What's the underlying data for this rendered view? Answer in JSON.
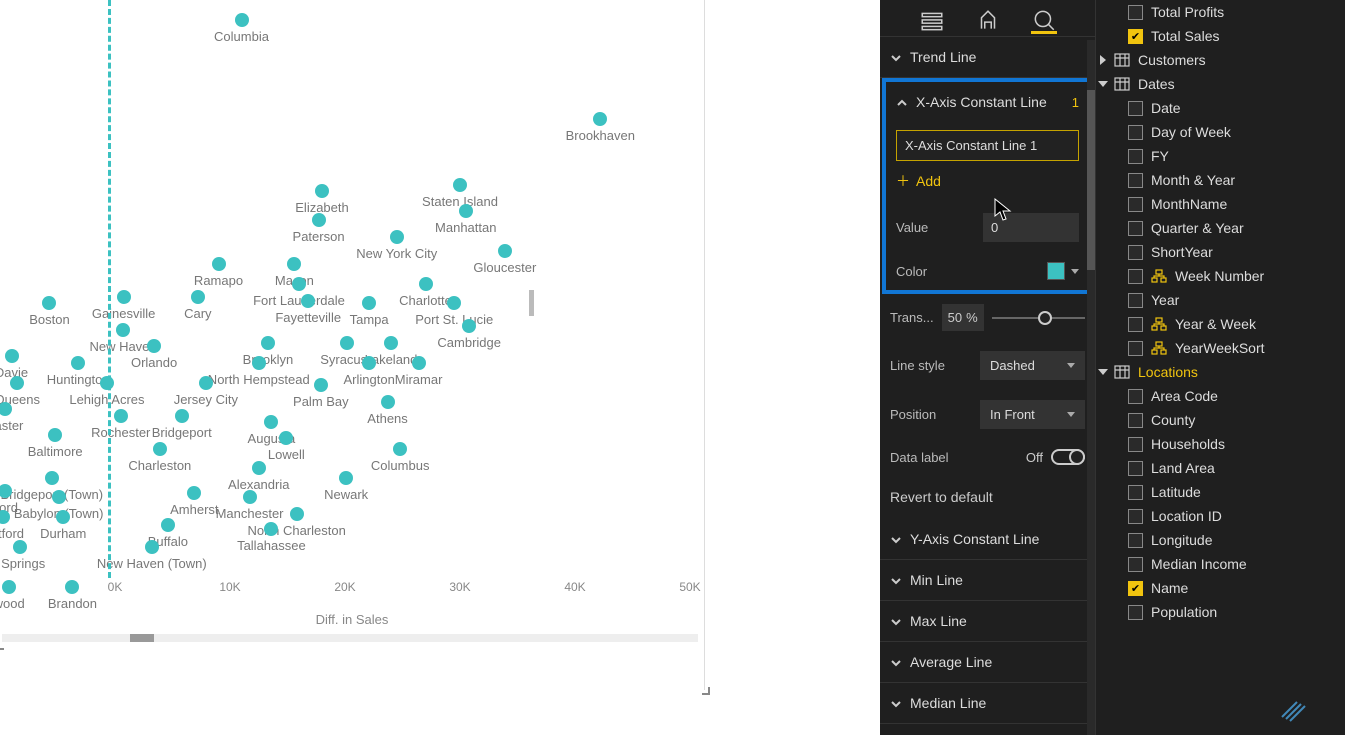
{
  "chart_data": {
    "type": "scatter",
    "xlabel": "Diff. in Sales",
    "x_ticks": [
      0,
      10000,
      20000,
      30000,
      40000,
      50000
    ],
    "x_tick_labels": [
      "0K",
      "10K",
      "20K",
      "30K",
      "40K",
      "50K"
    ],
    "ref_line_x": 0,
    "points": [
      {
        "label": "Columbia",
        "x": 11000,
        "y": 605
      },
      {
        "label": "Brookhaven",
        "x": 42200,
        "y": 530
      },
      {
        "label": "Staten Island",
        "x": 30000,
        "y": 480
      },
      {
        "label": "Elizabeth",
        "x": 18000,
        "y": 475
      },
      {
        "label": "Manhattan",
        "x": 30500,
        "y": 460
      },
      {
        "label": "Paterson",
        "x": 17700,
        "y": 453
      },
      {
        "label": "New York City",
        "x": 24500,
        "y": 440
      },
      {
        "label": "Ramapo",
        "x": 9000,
        "y": 420
      },
      {
        "label": "Macon",
        "x": 15600,
        "y": 420
      },
      {
        "label": "Fort Lauderdale",
        "x": 16000,
        "y": 405
      },
      {
        "label": "Charlotte",
        "x": 27000,
        "y": 405
      },
      {
        "label": "Gloucester",
        "x": 33900,
        "y": 430
      },
      {
        "label": "Gainesville",
        "x": 750,
        "y": 395
      },
      {
        "label": "Cary",
        "x": 7200,
        "y": 395
      },
      {
        "label": "Fayetteville",
        "x": 16800,
        "y": 392
      },
      {
        "label": "Tampa",
        "x": 22100,
        "y": 390
      },
      {
        "label": "Port St. Lucie",
        "x": 29500,
        "y": 390
      },
      {
        "label": "Cambridge",
        "x": 30800,
        "y": 373
      },
      {
        "label": "Boston",
        "x": -5700,
        "y": 390
      },
      {
        "label": "New Haven",
        "x": 700,
        "y": 370
      },
      {
        "label": "Orlando",
        "x": 3400,
        "y": 358
      },
      {
        "label": "Brooklyn",
        "x": 13300,
        "y": 360
      },
      {
        "label": "Syracuse",
        "x": 20200,
        "y": 360
      },
      {
        "label": "Lakeland",
        "x": 24000,
        "y": 360
      },
      {
        "label": "Huntington",
        "x": -3200,
        "y": 345
      },
      {
        "label": "North Hempstead",
        "x": 12500,
        "y": 345
      },
      {
        "label": "Arlington",
        "x": 22100,
        "y": 345
      },
      {
        "label": "Miramar",
        "x": 26400,
        "y": 345
      },
      {
        "label": "Davie",
        "x": -9000,
        "y": 350
      },
      {
        "label": "Queens",
        "x": -8500,
        "y": 330
      },
      {
        "label": "Lehigh Acres",
        "x": -700,
        "y": 330
      },
      {
        "label": "Jersey City",
        "x": 7900,
        "y": 330
      },
      {
        "label": "Palm Bay",
        "x": 17900,
        "y": 328
      },
      {
        "label": "Athens",
        "x": 23700,
        "y": 315
      },
      {
        "label": "Easter",
        "x": -9600,
        "y": 310
      },
      {
        "label": "Rochester",
        "x": 500,
        "y": 305
      },
      {
        "label": "Bridgeport",
        "x": 5800,
        "y": 305
      },
      {
        "label": "Augusta",
        "x": 13600,
        "y": 300
      },
      {
        "label": "Lowell",
        "x": 14900,
        "y": 288
      },
      {
        "label": "Columbus",
        "x": 24800,
        "y": 280
      },
      {
        "label": "Baltimore",
        "x": -5200,
        "y": 290
      },
      {
        "label": "Charleston",
        "x": 3900,
        "y": 280
      },
      {
        "label": "Alexandria",
        "x": 12500,
        "y": 265
      },
      {
        "label": "Newark",
        "x": 20100,
        "y": 258
      },
      {
        "label": "Bridgeport (Town)",
        "x": -5500,
        "y": 258
      },
      {
        "label": "Amherst",
        "x": 6900,
        "y": 246
      },
      {
        "label": "Manchester",
        "x": 11700,
        "y": 243
      },
      {
        "label": "North Charleston",
        "x": 15800,
        "y": 230
      },
      {
        "label": "Ford",
        "x": -9600,
        "y": 248
      },
      {
        "label": "Babylon (Town)",
        "x": -4900,
        "y": 243
      },
      {
        "label": "Iartford",
        "x": -9700,
        "y": 228
      },
      {
        "label": "Durham",
        "x": -4500,
        "y": 228
      },
      {
        "label": "Buffalo",
        "x": 4600,
        "y": 222
      },
      {
        "label": "Tallahassee",
        "x": 13600,
        "y": 219
      },
      {
        "label": "I Springs",
        "x": -8300,
        "y": 205
      },
      {
        "label": "New Haven (Town)",
        "x": 3200,
        "y": 205
      },
      {
        "label": "wood",
        "x": -9200,
        "y": 175
      },
      {
        "label": "Brandon",
        "x": -3700,
        "y": 175
      }
    ]
  },
  "chart": {
    "x_axis_title": "Diff. in Sales"
  },
  "analytics": {
    "trend_line": "Trend Line",
    "x_const": {
      "title": "X-Axis Constant Line",
      "count": "1",
      "item_name": "X-Axis Constant Line 1",
      "add": "Add",
      "value_label": "Value",
      "value": "0",
      "color_label": "Color",
      "trans_label": "Trans...",
      "trans_val": "50",
      "trans_pct": "%",
      "style_label": "Line style",
      "style_val": "Dashed",
      "position_label": "Position",
      "position_val": "In Front",
      "datalabel_label": "Data label",
      "datalabel_state": "Off"
    },
    "revert": "Revert to default",
    "y_const": "Y-Axis Constant Line",
    "min_line": "Min Line",
    "max_line": "Max Line",
    "avg_line": "Average Line",
    "med_line": "Median Line"
  },
  "fields": {
    "total_profits": "Total Profits",
    "total_sales": "Total Sales",
    "customers": "Customers",
    "dates": "Dates",
    "date": "Date",
    "dow": "Day of Week",
    "fy": "FY",
    "my": "Month & Year",
    "monthname": "MonthName",
    "qy": "Quarter & Year",
    "shortyear": "ShortYear",
    "weeknum": "Week Number",
    "year": "Year",
    "yw": "Year & Week",
    "yws": "YearWeekSort",
    "locations": "Locations",
    "areacode": "Area Code",
    "county": "County",
    "households": "Households",
    "landarea": "Land Area",
    "latitude": "Latitude",
    "locationid": "Location ID",
    "longitude": "Longitude",
    "medinc": "Median Income",
    "name": "Name",
    "population": "Population"
  }
}
